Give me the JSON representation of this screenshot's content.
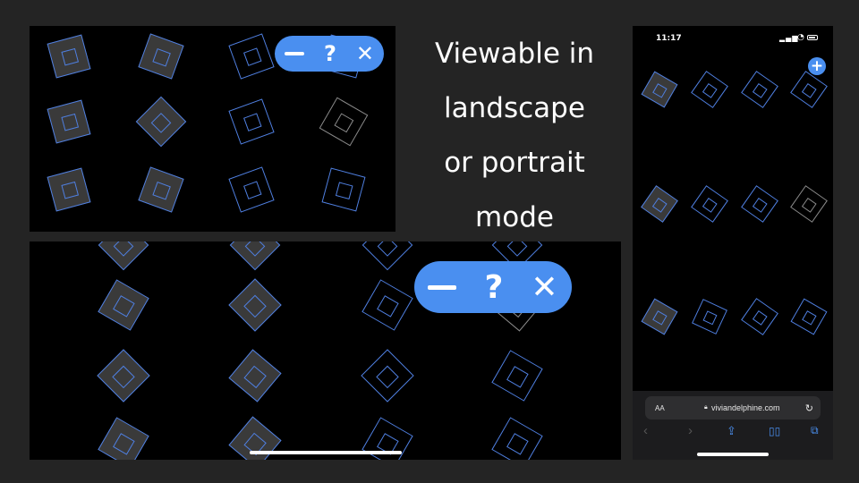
{
  "caption": {
    "lines": [
      "Viewable in",
      "landscape",
      "or portrait",
      "mode"
    ]
  },
  "controls": {
    "minus_icon": "minus-icon",
    "help_label": "?",
    "close_label": "✕"
  },
  "phone": {
    "time": "11:17",
    "url": "viviandelphine.com",
    "text_size_label": "AA",
    "add_label": "+"
  },
  "colors": {
    "background": "#242424",
    "screen": "#000000",
    "accent": "#4a8ff0",
    "square_fill": "#3a3a3a",
    "square_outline": "#4f7fe0",
    "grey_outline": "#8a8a8a"
  }
}
